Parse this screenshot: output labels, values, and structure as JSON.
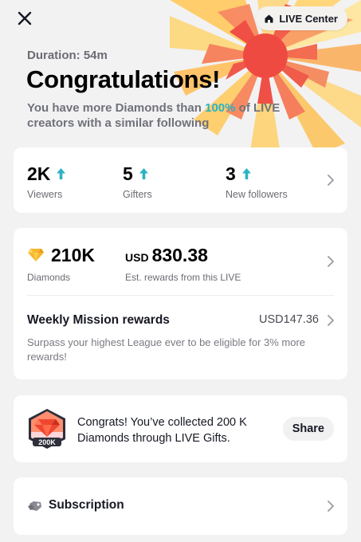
{
  "header": {
    "live_center_label": "LIVE Center",
    "duration": "Duration: 54m",
    "title": "Congratulations!",
    "subtitle_before": "You have more Diamonds than ",
    "subtitle_highlight": "100%",
    "subtitle_after": " of LIVE creators with a similar following",
    "highlight_color": "#2bb3c3"
  },
  "stats": [
    {
      "value": "2K",
      "label": "Viewers",
      "icon": "arrow-up-icon"
    },
    {
      "value": "5",
      "label": "Gifters",
      "icon": "arrow-up-icon"
    },
    {
      "value": "3",
      "label": "New followers",
      "icon": "arrow-up-icon"
    }
  ],
  "rewards": {
    "diamonds_value": "210K",
    "diamonds_label": "Diamonds",
    "usd_prefix": "USD",
    "usd_value": "830.38",
    "usd_label": "Est. rewards from this LIVE",
    "mission_title": "Weekly Mission rewards",
    "mission_amount": "USD147.36",
    "mission_desc": "Surpass your highest League ever to be eligible for 3% more rewards!"
  },
  "milestone": {
    "badge_text": "200K",
    "message": "Congrats! You’ve collected 200 K Diamonds through LIVE Gifts.",
    "share_label": "Share"
  },
  "subscription": {
    "label": "Subscription"
  },
  "colors": {
    "arrow": "#2bb3c3",
    "background": "#f2f2f3",
    "card": "#ffffff"
  }
}
